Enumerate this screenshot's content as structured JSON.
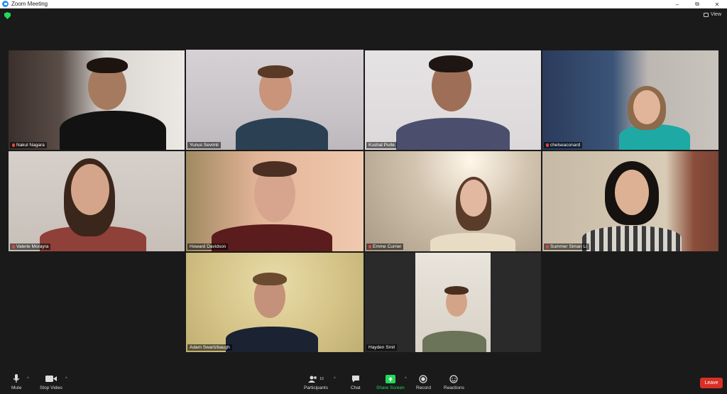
{
  "window": {
    "title": "Zoom Meeting",
    "controls": [
      "–",
      "⧉",
      "✕"
    ]
  },
  "header": {
    "view_label": "View"
  },
  "participants": [
    {
      "name": "Nakul Nagara"
    },
    {
      "name": "Yunus Sevimli"
    },
    {
      "name": "Kushal Purle"
    },
    {
      "name": "chelseaconard"
    },
    {
      "name": "Valerie Morayra"
    },
    {
      "name": "Howard Davidson"
    },
    {
      "name": "Emme Currier"
    },
    {
      "name": "Summer Siman Li"
    },
    {
      "name": "Adam Swartzbaugh"
    },
    {
      "name": "Hayden Smit"
    }
  ],
  "toolbar": {
    "mute": "Mute",
    "stop_video": "Stop Video",
    "participants": "Participants",
    "participants_count": "10",
    "chat": "Chat",
    "share_screen": "Share Screen",
    "record": "Record",
    "reactions": "Reactions",
    "leave": "Leave"
  },
  "colors": {
    "accent_green": "#23d959",
    "active_speaker": "#b8d66b",
    "leave_red": "#d93025",
    "background": "#1a1a1a"
  }
}
